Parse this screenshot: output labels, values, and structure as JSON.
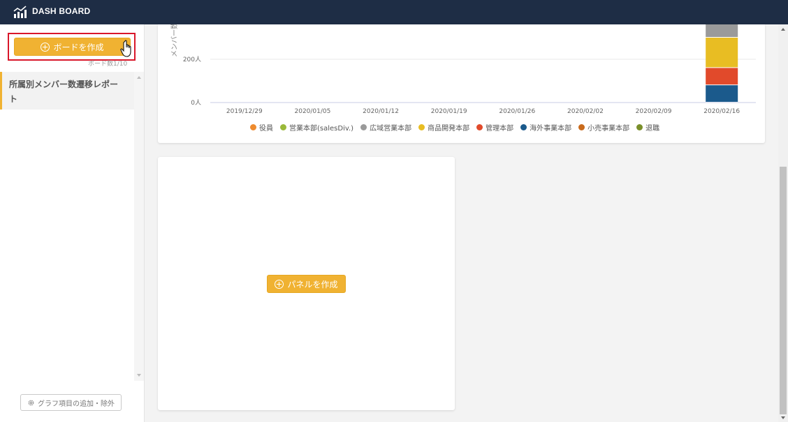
{
  "header": {
    "title": "DASH BOARD",
    "logo_icon": "chart-bar-line-icon"
  },
  "sidebar": {
    "create_board_label": "ボードを作成",
    "board_count": "ボード数1/10",
    "items": [
      {
        "label": "所属別メンバー数遷移レポート"
      }
    ],
    "graph_settings_label": "グラフ項目の追加・除外"
  },
  "chart_data": {
    "type": "bar",
    "stacked": true,
    "ylabel": "メンバー数",
    "y_tick_labels": [
      "0人",
      "200人"
    ],
    "categories": [
      "2019/12/29",
      "2020/01/05",
      "2020/01/12",
      "2020/01/19",
      "2020/01/26",
      "2020/02/02",
      "2020/02/09",
      "2020/02/16"
    ],
    "series": [
      {
        "name": "役員",
        "color": "#ee8b2f",
        "values": [
          0,
          0,
          0,
          0,
          0,
          0,
          0,
          0
        ]
      },
      {
        "name": "営業本部(salesDiv.)",
        "color": "#9ab93a",
        "values": [
          0,
          0,
          0,
          0,
          0,
          0,
          0,
          0
        ]
      },
      {
        "name": "広域営業本部",
        "color": "#9a9a9a",
        "values": [
          0,
          0,
          0,
          0,
          0,
          0,
          0,
          70
        ]
      },
      {
        "name": "商品開発本部",
        "color": "#e8bd23",
        "values": [
          0,
          0,
          0,
          0,
          0,
          0,
          0,
          140
        ]
      },
      {
        "name": "管理本部",
        "color": "#e14a2b",
        "values": [
          0,
          0,
          0,
          0,
          0,
          0,
          0,
          80
        ]
      },
      {
        "name": "海外事業本部",
        "color": "#1b5a8c",
        "values": [
          0,
          0,
          0,
          0,
          0,
          0,
          0,
          80
        ]
      },
      {
        "name": "小売事業本部",
        "color": "#c96a1c",
        "values": [
          0,
          0,
          0,
          0,
          0,
          0,
          0,
          0
        ]
      },
      {
        "name": "退職",
        "color": "#7a8f2a",
        "values": [
          0,
          0,
          0,
          0,
          0,
          0,
          0,
          0
        ]
      }
    ],
    "stack_order": [
      "海外事業本部",
      "管理本部",
      "商品開発本部",
      "広域営業本部"
    ],
    "ylim": [
      0,
      360
    ],
    "grid": true,
    "legend_position": "bottom"
  },
  "panel": {
    "create_panel_label": "パネルを作成"
  }
}
